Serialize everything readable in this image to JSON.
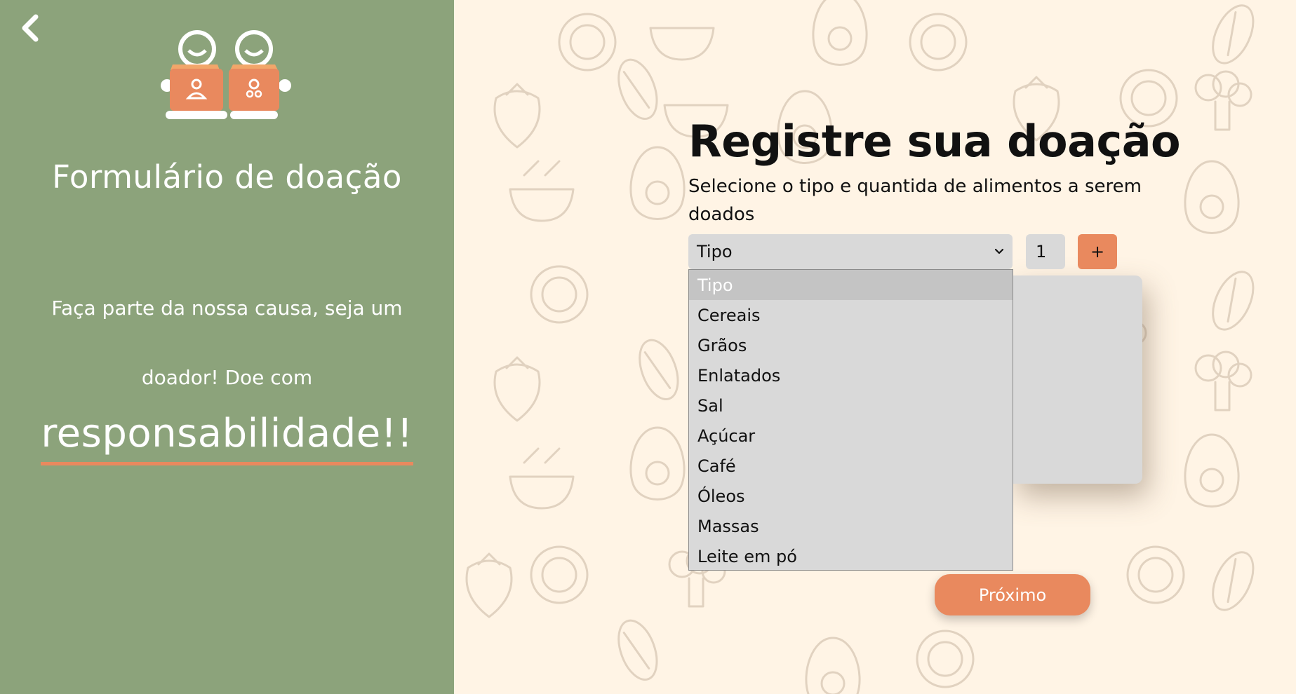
{
  "sidebar": {
    "back_icon": "chevron-left-icon",
    "logo_icon": "donation-people-boxes-logo",
    "title": "Formulário de doação",
    "tagline": "Faça parte da nossa causa, seja um doador! Doe com",
    "highlight": "responsabilidade!!",
    "colors": {
      "background": "#8ca37b",
      "accent": "#e9895e"
    }
  },
  "form": {
    "title": "Registre sua doação",
    "subtitle": "Selecione o tipo e quantida de alimentos a serem doados",
    "type_select": {
      "selected": "Tipo",
      "options": [
        "Tipo",
        "Cereais",
        "Grãos",
        "Enlatados",
        "Sal",
        "Açúcar",
        "Café",
        "Óleos",
        "Massas",
        "Leite em pó"
      ]
    },
    "quantity": "1",
    "add_label": "+",
    "next_label": "Próximo"
  },
  "colors": {
    "page_background": "#fff4e5",
    "field": "#d9d9d9",
    "button": "#e9895e"
  }
}
